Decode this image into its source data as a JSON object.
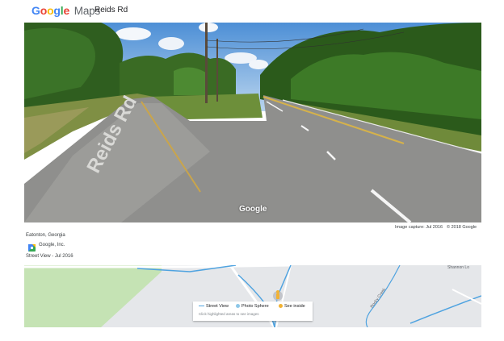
{
  "header": {
    "logo_word": "Google",
    "logo_product": "Maps",
    "place_title": "Reids Rd"
  },
  "pano": {
    "watermark": "Google",
    "road_sign": "Reids Rd",
    "image_capture": "Image capture: Jul 2016",
    "copyright": "© 2018 Google"
  },
  "info": {
    "location": "Eatonton, Georgia",
    "contributor": "Google, Inc.",
    "street_view_date": "Street View - Jul 2016"
  },
  "map": {
    "place_label": "Shannon Lo",
    "road_labels": [
      "Reids Rd",
      "Rocky Creek",
      "Rocky Creek Rd"
    ],
    "legend": {
      "street_view": "Street View",
      "photo_sphere": "Photo Sphere",
      "see_inside": "See inside",
      "hint": "Click highlighted areas to see images"
    }
  },
  "colors": {
    "street_view_line": "#4fa3e0",
    "photo_sphere": "#8ec7e8",
    "see_inside": "#f2b233",
    "pegman": "#f2b233",
    "map_park": "#c5e3b4"
  }
}
